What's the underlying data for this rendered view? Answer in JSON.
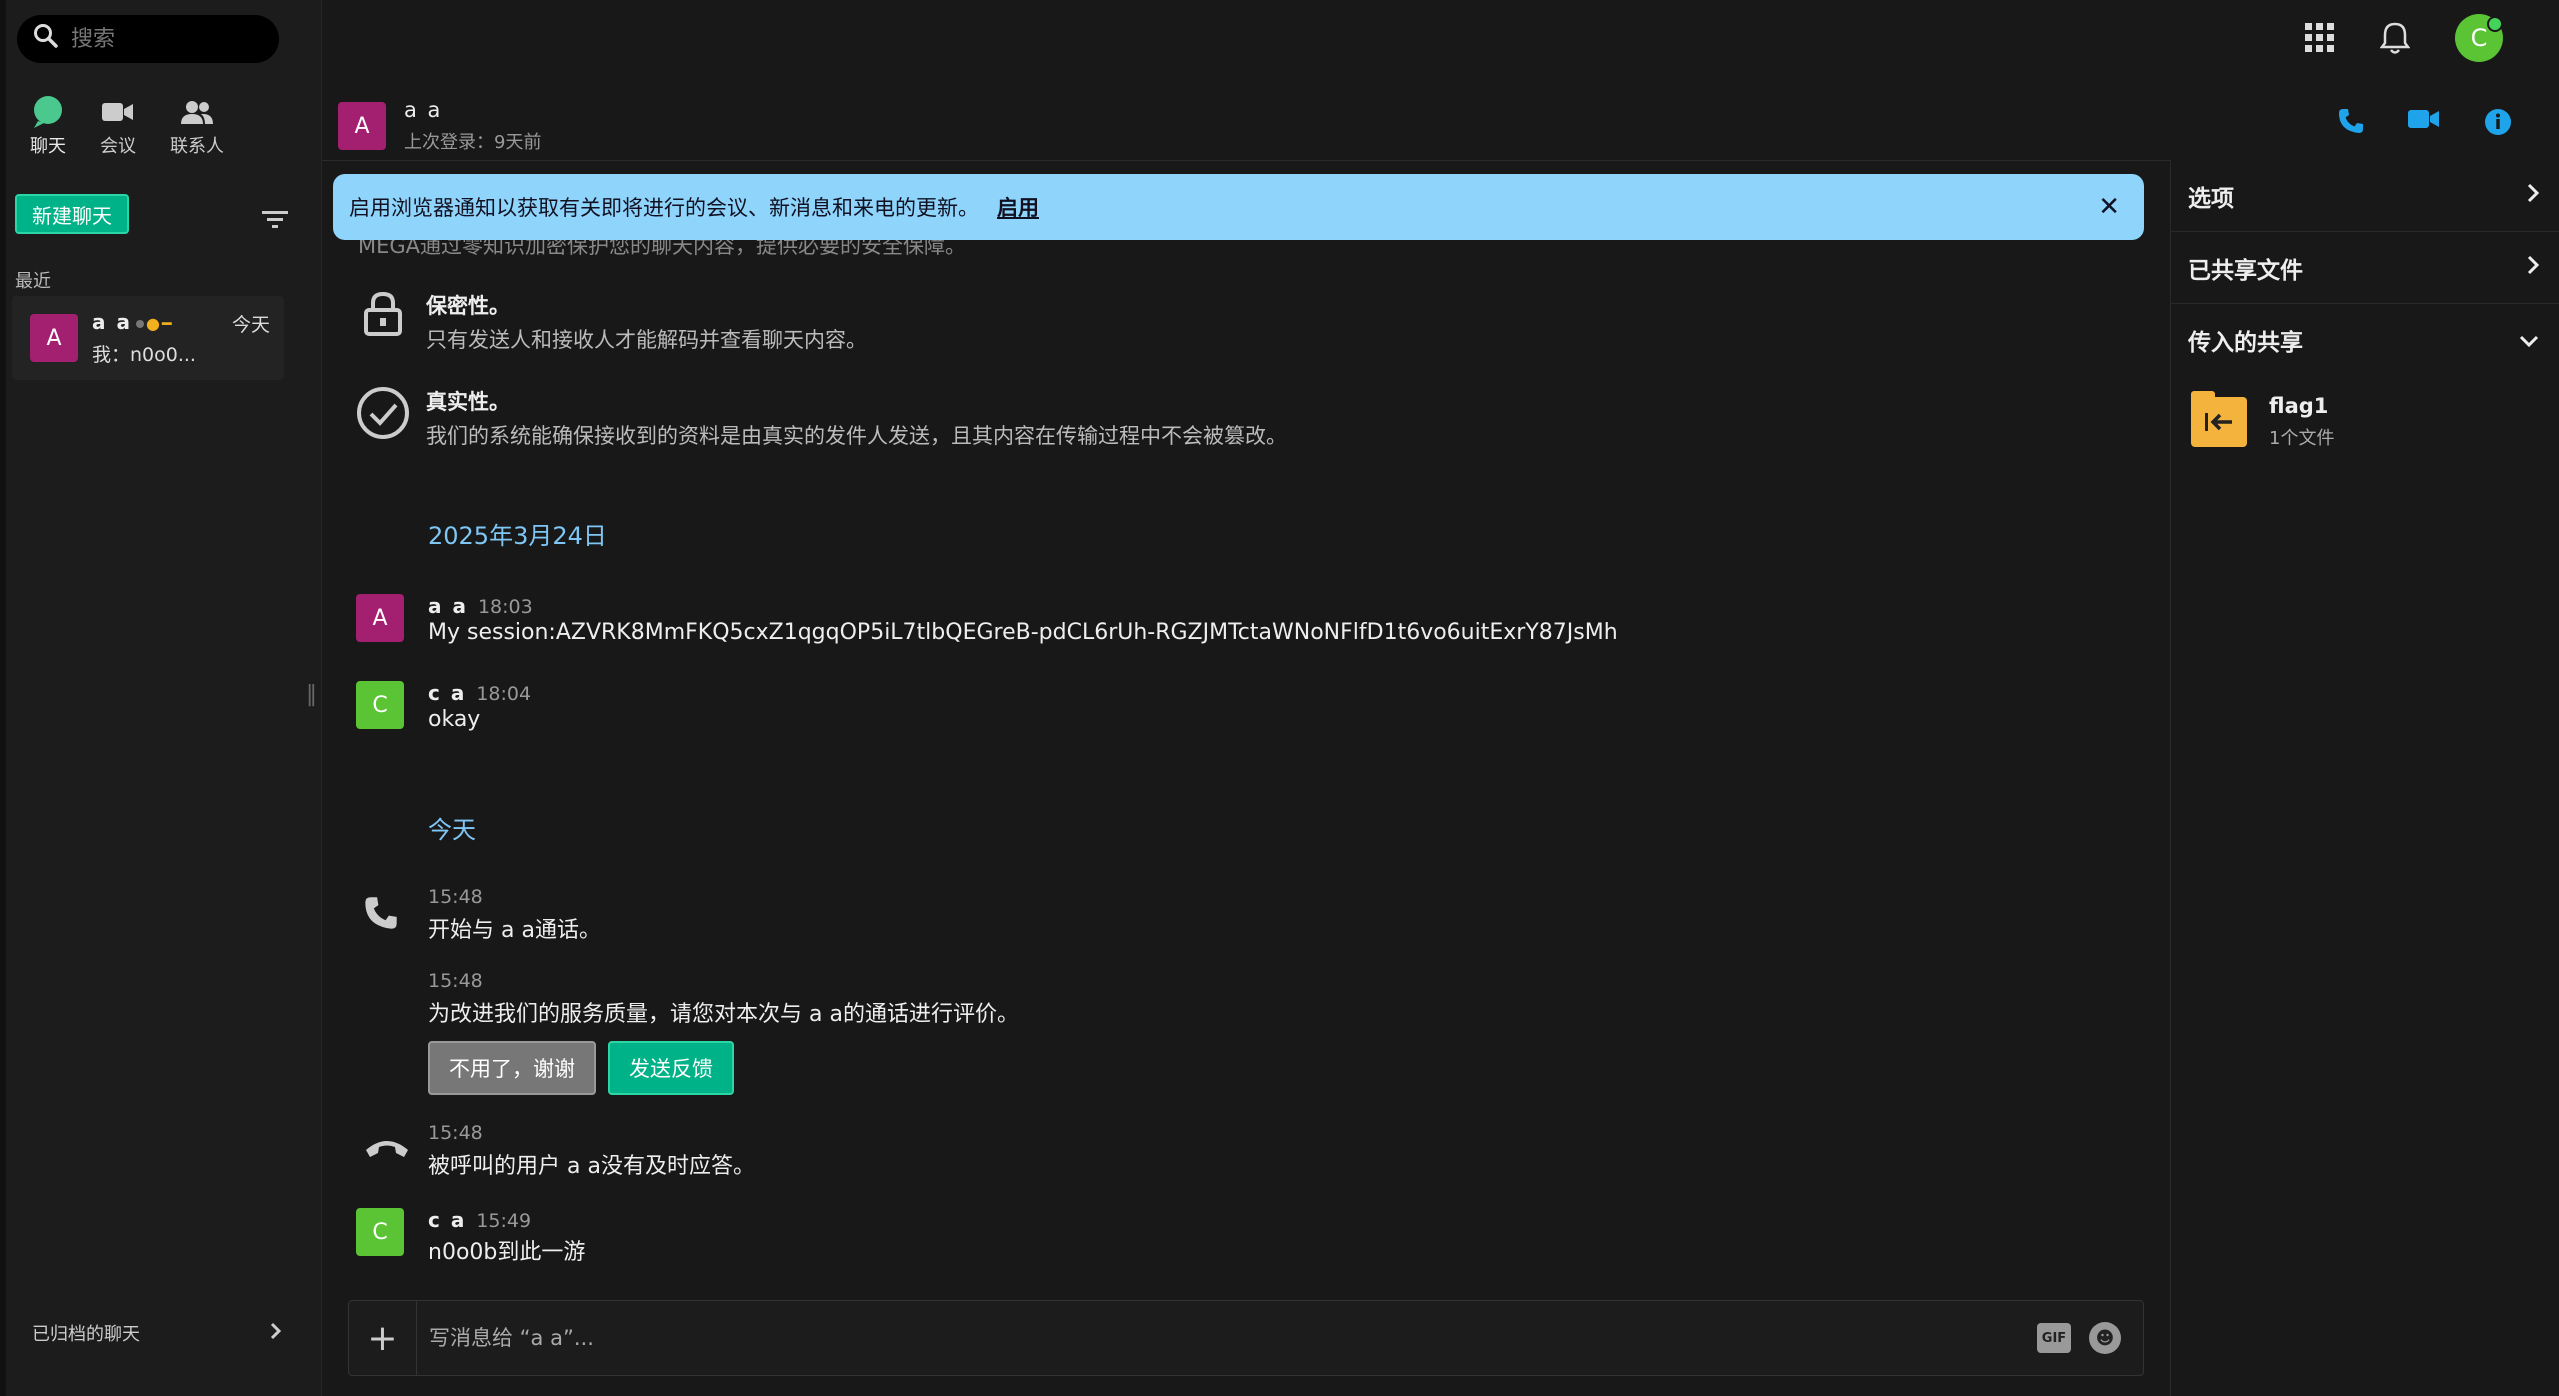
{
  "search": {
    "placeholder": "搜索"
  },
  "nav": [
    {
      "label": "聊天",
      "icon": "chat-icon"
    },
    {
      "label": "会议",
      "icon": "video-icon"
    },
    {
      "label": "联系人",
      "icon": "contacts-icon"
    }
  ],
  "new_chat": "新建聊天",
  "recent_label": "最近",
  "chat_list": [
    {
      "initial": "A",
      "name": "a a",
      "time": "今天",
      "preview": "我：n0o0..."
    }
  ],
  "archived": "已归档的聊天",
  "conversation": {
    "initial": "A",
    "name": "a a",
    "status": "上次登录：9天前"
  },
  "banner": {
    "text": "启用浏览器通知以获取有关即将进行的会议、新消息和来电的更新。",
    "link": "启用",
    "close": "✕"
  },
  "cut_text": "MEGA通过零知识加密保护您的聊天内容，提供必要的安全保障。",
  "info": [
    {
      "title": "保密性。",
      "text": "只有发送人和接收人才能解码并查看聊天内容。",
      "icon": "lock-icon"
    },
    {
      "title": "真实性。",
      "text": "我们的系统能确保接收到的资料是由真实的发件人发送，且其内容在传输过程中不会被篡改。",
      "icon": "check-circle-icon"
    }
  ],
  "dates": [
    "2025年3月24日",
    "今天"
  ],
  "messages": [
    {
      "initial": "A",
      "sender": "a a",
      "time": "18:03",
      "text": "My session:AZVRK8MmFKQ5cxZ1qgqOP5iL7tlbQEGreB-pdCL6rUh-RGZJMTctaWNoNFlfD1t6vo6uitExrY87JsMh"
    },
    {
      "initial": "C",
      "sender": "c a",
      "time": "18:04",
      "text": "okay"
    },
    {
      "initial": "C",
      "sender": "c a",
      "time": "15:49",
      "text": "n0o0b到此一游"
    }
  ],
  "system": [
    {
      "time": "15:48",
      "text": "开始与 a a通话。"
    },
    {
      "time": "15:48",
      "text": "为改进我们的服务质量，请您对本次与 a a的通话进行评价。"
    },
    {
      "time": "15:48",
      "text": "被呼叫的用户 a a没有及时应答。"
    }
  ],
  "feedback": {
    "no": "不用了，谢谢",
    "yes": "发送反馈"
  },
  "composer": {
    "placeholder": "写消息给 “a a”...",
    "gif": "GIF"
  },
  "user_initial": "C",
  "right_panel": {
    "options": "选项",
    "shared_files": "已共享文件",
    "incoming_shares": "传入的共享",
    "share": {
      "name": "flag1",
      "count": "1个文件"
    }
  },
  "colors": {
    "accent": "#00b287",
    "banner": "#8ed4fb",
    "date": "#7fc6f5",
    "avatar_a": "#a31f70",
    "avatar_c": "#5bc435",
    "icon_blue": "#1fa3ea"
  }
}
